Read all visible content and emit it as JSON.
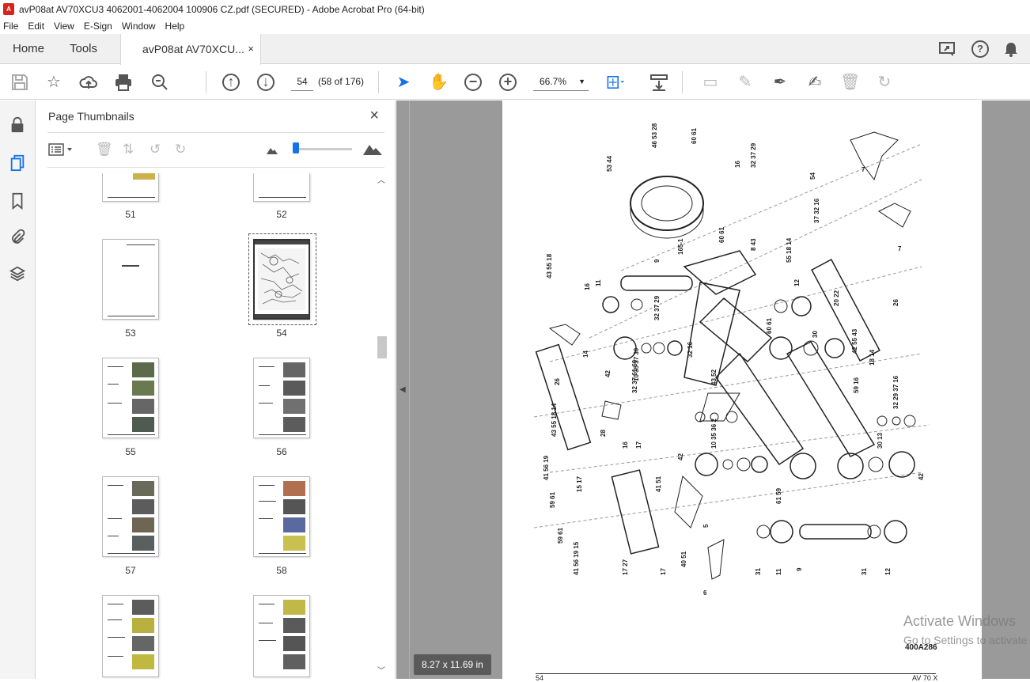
{
  "window": {
    "title": "avP08at AV70XCU3 4062001-4062004 100906 CZ.pdf (SECURED) - Adobe Acrobat Pro (64-bit)",
    "icon": "pdf-icon"
  },
  "menu": [
    "File",
    "Edit",
    "View",
    "E-Sign",
    "Window",
    "Help"
  ],
  "tabs": {
    "home": "Home",
    "tools": "Tools",
    "document": "avP08at AV70XCU...",
    "close": "×"
  },
  "toolbar": {
    "page_number": "54",
    "page_count": "(58 of 176)",
    "zoom": "66.7%"
  },
  "panel": {
    "title": "Page Thumbnails",
    "close": "×",
    "thumbnails": [
      "51",
      "52",
      "53",
      "54",
      "55",
      "56",
      "57",
      "58"
    ]
  },
  "page": {
    "size": "8.27 x 11.69 in",
    "drawing_code": "400A286",
    "footer_page": "54",
    "footer_model": "AV 70 X"
  },
  "watermark": {
    "line1": "Activate Windows",
    "line2": "Go to Settings to activate"
  },
  "colors": {
    "accent": "#1473e6",
    "pdf_red": "#d4261d",
    "canvas_gray": "#9a9a9a"
  }
}
